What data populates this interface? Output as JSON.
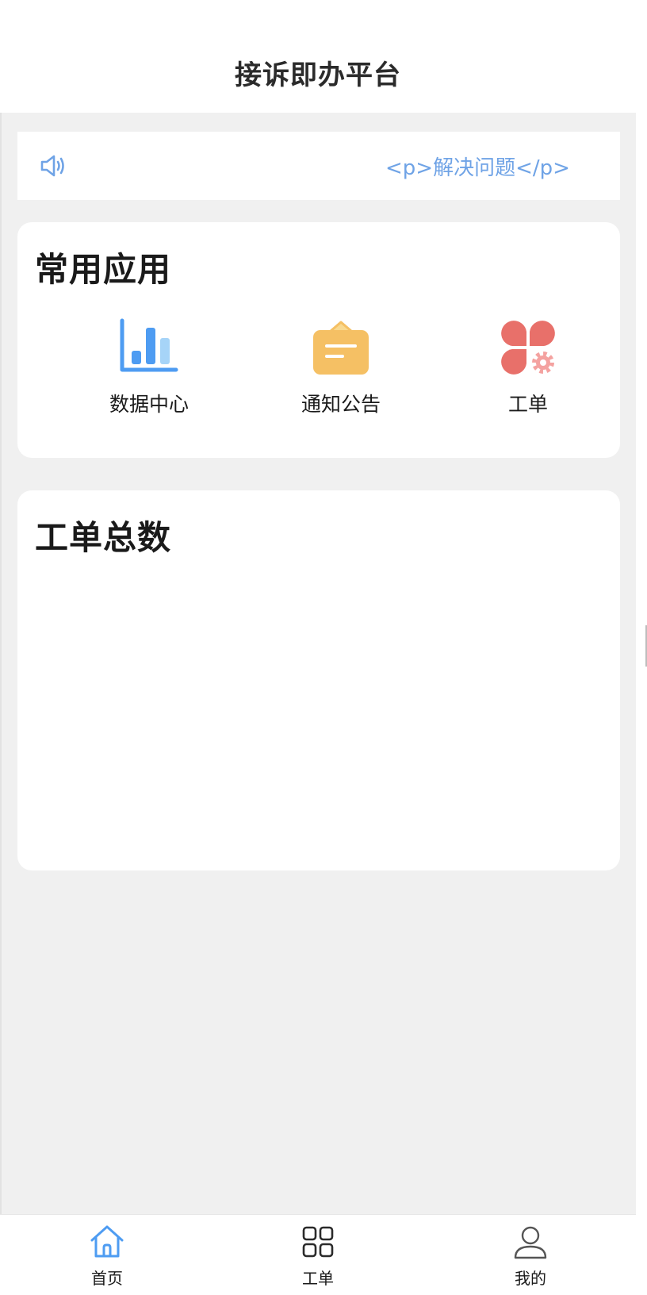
{
  "header": {
    "title": "接诉即办平台"
  },
  "notice": {
    "icon": "speaker-icon",
    "text": "<p>解决问题</p>",
    "color": "#6fa3e6"
  },
  "common_apps": {
    "title": "常用应用",
    "items": [
      {
        "label": "数据中心",
        "icon": "bar-chart-icon",
        "color": "#4e9cf2"
      },
      {
        "label": "通知公告",
        "icon": "notice-board-icon",
        "color": "#f5c064"
      },
      {
        "label": "工单",
        "icon": "work-order-icon",
        "color": "#e8706a"
      }
    ]
  },
  "orders_total": {
    "title": "工单总数"
  },
  "tabbar": {
    "active_color": "#4e9cf2",
    "items": [
      {
        "label": "首页",
        "icon": "home-icon",
        "active": true
      },
      {
        "label": "工单",
        "icon": "grid-icon",
        "active": false
      },
      {
        "label": "我的",
        "icon": "user-icon",
        "active": false
      }
    ]
  }
}
